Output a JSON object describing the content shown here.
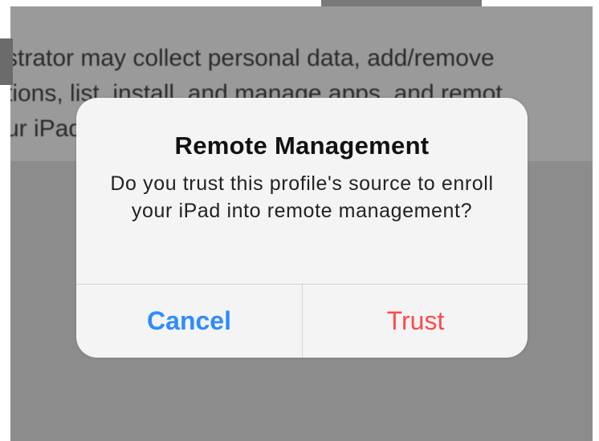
{
  "background": {
    "lines": [
      "strator may collect personal data, add/remove",
      "tions, list, install, and manage apps, and remot",
      "ur iPad"
    ]
  },
  "alert": {
    "title": "Remote Management",
    "message": "Do you trust this profile's source to enroll your iPad into remote management?",
    "buttons": {
      "cancel": "Cancel",
      "trust": "Trust"
    }
  },
  "colors": {
    "cancel": "#2f8bff",
    "trust": "#ff4b4b",
    "dim_overlay": "#8c8c8c",
    "alert_background": "#f4f4f4"
  }
}
